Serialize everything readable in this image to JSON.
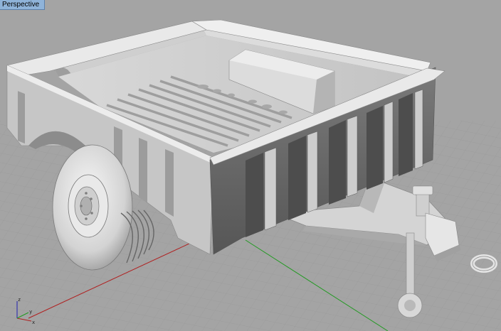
{
  "viewport": {
    "title": "Perspective",
    "active": true
  },
  "axes": {
    "x_label": "x",
    "y_label": "y",
    "z_label": "z",
    "x_axis_color": "#b02020",
    "y_axis_color": "#209a20",
    "z_axis_color": "#2020b0"
  },
  "colors": {
    "background": "#a4a4a4",
    "grid_line": "#9a9a9a",
    "tab_background": "#8fb3d9"
  }
}
